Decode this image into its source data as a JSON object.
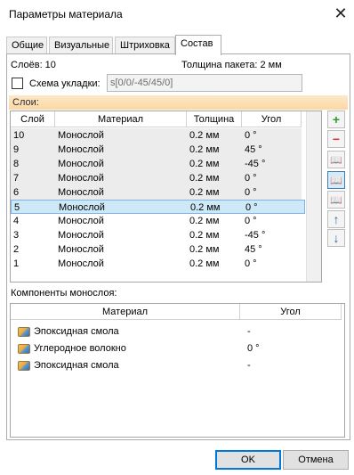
{
  "window": {
    "title": "Параметры материала",
    "close_glyph": "✕"
  },
  "tabs": [
    {
      "label": "Общие",
      "active": false
    },
    {
      "label": "Визуальные",
      "active": false
    },
    {
      "label": "Штриховка",
      "active": false
    },
    {
      "label": "Состав",
      "active": true
    }
  ],
  "summary": {
    "layer_count": "Слоёв: 10",
    "package_thickness": "Толщина пакета: 2 мм"
  },
  "layup_scheme": {
    "label": "Схема укладки:",
    "checked": false,
    "value": "s[0/0/-45/45/0]"
  },
  "layers": {
    "header": "Слои:",
    "columns": [
      "Слой",
      "Материал",
      "Толщина",
      "Угол"
    ],
    "rows": [
      {
        "layer": "10",
        "material": "Монослой",
        "thickness": "0.2 мм",
        "angle": "0 °"
      },
      {
        "layer": "9",
        "material": "Монослой",
        "thickness": "0.2 мм",
        "angle": "45 °"
      },
      {
        "layer": "8",
        "material": "Монослой",
        "thickness": "0.2 мм",
        "angle": "-45 °"
      },
      {
        "layer": "7",
        "material": "Монослой",
        "thickness": "0.2 мм",
        "angle": "0 °"
      },
      {
        "layer": "6",
        "material": "Монослой",
        "thickness": "0.2 мм",
        "angle": "0 °"
      },
      {
        "layer": "5",
        "material": "Монослой",
        "thickness": "0.2 мм",
        "angle": "0 °"
      },
      {
        "layer": "4",
        "material": "Монослой",
        "thickness": "0.2 мм",
        "angle": "0 °"
      },
      {
        "layer": "3",
        "material": "Монослой",
        "thickness": "0.2 мм",
        "angle": "-45 °"
      },
      {
        "layer": "2",
        "material": "Монослой",
        "thickness": "0.2 мм",
        "angle": "45 °"
      },
      {
        "layer": "1",
        "material": "Монослой",
        "thickness": "0.2 мм",
        "angle": "0 °"
      }
    ],
    "selected_layer": "5"
  },
  "side_buttons": [
    {
      "name": "add-layer-button",
      "icon": "plus-icon",
      "glyph": "+",
      "color": "#2e9b2e"
    },
    {
      "name": "remove-layer-button",
      "icon": "minus-icon",
      "glyph": "−",
      "color": "#d93838"
    },
    {
      "name": "flip-layer-left-button",
      "icon": "book-left-icon",
      "glyph": "📖",
      "color": "#3a7bb8"
    },
    {
      "name": "flip-layer-both-button",
      "icon": "book-open-icon",
      "glyph": "📖",
      "color": "#3a7bb8"
    },
    {
      "name": "flip-layer-right-button",
      "icon": "book-right-icon",
      "glyph": "📖",
      "color": "#3a7bb8"
    },
    {
      "name": "move-up-button",
      "icon": "arrow-up-icon",
      "glyph": "↑",
      "color": "#2f67a7"
    },
    {
      "name": "move-down-button",
      "icon": "arrow-down-icon",
      "glyph": "↓",
      "color": "#2f67a7"
    }
  ],
  "components": {
    "label": "Компоненты монослоя:",
    "columns": [
      "Материал",
      "Угол"
    ],
    "rows": [
      {
        "material": "Эпоксидная смола",
        "angle": "-",
        "icon": "material-icon"
      },
      {
        "material": "Углеродное волокно",
        "angle": "0 °",
        "icon": "material-icon"
      },
      {
        "material": "Эпоксидная смола",
        "angle": "-",
        "icon": "material-icon"
      }
    ]
  },
  "buttons": {
    "ok": "OK",
    "cancel": "Отмена"
  },
  "colors": {
    "selection_bg": "#cde8f6",
    "selection_border": "#7eb4ea",
    "header_bg": "#fbd7a4",
    "accent": "#0078d7"
  }
}
